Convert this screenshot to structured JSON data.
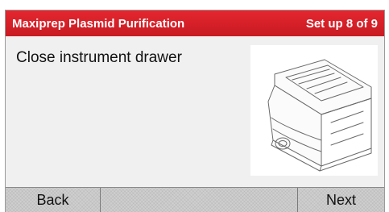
{
  "header": {
    "title": "Maxiprep Plasmid Purification",
    "step": "Set up 8 of 9"
  },
  "main": {
    "instruction": "Close instrument drawer",
    "illustration": "instrument-drawer-closed-illustration"
  },
  "footer": {
    "back_label": "Back",
    "next_label": "Next"
  },
  "colors": {
    "header_red": "#d62028",
    "header_text": "#ffffff",
    "panel_bg": "#f0f0f0",
    "button_bar": "#cfcfcf"
  }
}
